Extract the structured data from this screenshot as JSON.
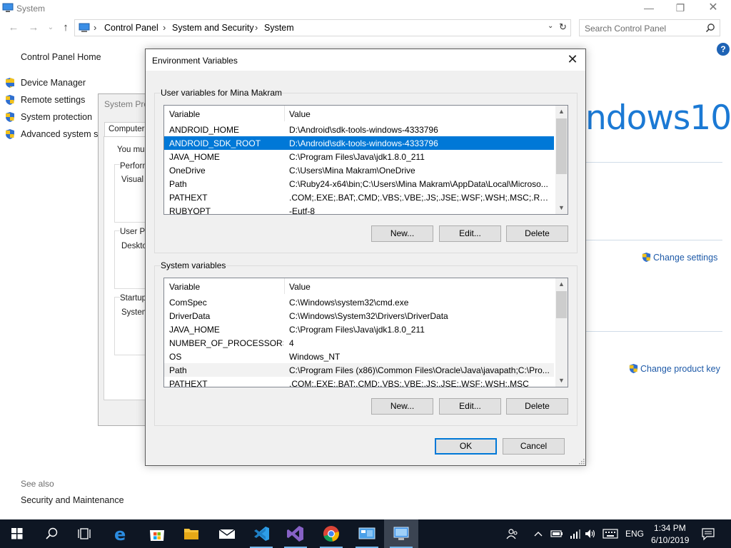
{
  "window": {
    "title": "System",
    "minimize_label": "—",
    "maximize_label": "❐",
    "close_label": "✕"
  },
  "nav": {
    "back": "←",
    "forward": "→",
    "recent": "⌄",
    "up": "↑",
    "breadcrumbs": [
      "Control Panel",
      "System and Security",
      "System"
    ],
    "separator": "›",
    "dropdown": "⌄",
    "refresh": "↻"
  },
  "search": {
    "placeholder": "Search Control Panel"
  },
  "help": "?",
  "sidebar": {
    "home": "Control Panel Home",
    "items": [
      {
        "label": "Device Manager"
      },
      {
        "label": "Remote settings"
      },
      {
        "label": "System protection"
      },
      {
        "label": "Advanced system settings"
      }
    ],
    "see_also": "See also",
    "see_also_items": [
      "Security and Maintenance"
    ]
  },
  "main": {
    "windows_logo_text": "ndows10",
    "change_settings": "Change settings",
    "change_product_key": "Change product key"
  },
  "system_properties": {
    "title": "System Properties",
    "tab": "Computer Name",
    "text_you_must": "You must be logged on as an Administrator",
    "perf_group": "Performance",
    "perf_text": "Visual effects",
    "user_profiles_group": "User Profiles",
    "user_profiles_text": "Desktop settings",
    "startup_group": "Startup and Recovery",
    "startup_text": "System startup"
  },
  "env_dialog": {
    "title": "Environment Variables",
    "close": "✕",
    "user_group_label": "User variables for Mina Makram",
    "system_group_label": "System variables",
    "col_variable": "Variable",
    "col_value": "Value",
    "user_vars": [
      {
        "name": "ANDROID_HOME",
        "value": "D:\\Android\\sdk-tools-windows-4333796"
      },
      {
        "name": "ANDROID_SDK_ROOT",
        "value": "D:\\Android\\sdk-tools-windows-4333796",
        "selected": true
      },
      {
        "name": "JAVA_HOME",
        "value": "C:\\Program Files\\Java\\jdk1.8.0_211"
      },
      {
        "name": "OneDrive",
        "value": "C:\\Users\\Mina Makram\\OneDrive"
      },
      {
        "name": "Path",
        "value": "C:\\Ruby24-x64\\bin;C:\\Users\\Mina Makram\\AppData\\Local\\Microso..."
      },
      {
        "name": "PATHEXT",
        "value": ".COM;.EXE;.BAT;.CMD;.VBS;.VBE;.JS;.JSE;.WSF;.WSH;.MSC;.RB;.RBW;..."
      },
      {
        "name": "RUBYOPT",
        "value": "-Eutf-8"
      }
    ],
    "system_vars": [
      {
        "name": "ComSpec",
        "value": "C:\\Windows\\system32\\cmd.exe"
      },
      {
        "name": "DriverData",
        "value": "C:\\Windows\\System32\\Drivers\\DriverData"
      },
      {
        "name": "JAVA_HOME",
        "value": "C:\\Program Files\\Java\\jdk1.8.0_211"
      },
      {
        "name": "NUMBER_OF_PROCESSORS",
        "value": "4"
      },
      {
        "name": "OS",
        "value": "Windows_NT"
      },
      {
        "name": "Path",
        "value": "C:\\Program Files (x86)\\Common Files\\Oracle\\Java\\javapath;C:\\Pro...",
        "hover": true
      },
      {
        "name": "PATHEXT",
        "value": ".COM;.EXE;.BAT;.CMD;.VBS;.VBE;.JS;.JSE;.WSF;.WSH;.MSC"
      }
    ],
    "buttons": {
      "user_new": "New...",
      "user_edit": "Edit...",
      "user_delete": "Delete",
      "sys_new": "New...",
      "sys_edit": "Edit...",
      "sys_delete": "Delete",
      "ok": "OK",
      "cancel": "Cancel"
    },
    "scroll_up": "▲",
    "scroll_down": "▼"
  },
  "taskbar": {
    "apps": [
      "start",
      "search",
      "task-view",
      "edge",
      "store",
      "file-explorer",
      "mail",
      "vscode",
      "visual-studio",
      "chrome",
      "control-panel",
      "system-properties"
    ],
    "language": "ENG",
    "time": "1:34 PM",
    "date": "6/10/2019"
  },
  "colors": {
    "accent": "#0078d7",
    "link": "#1e5aa8",
    "windows_logo": "#1b79d4",
    "taskbar": "#0e1623"
  }
}
